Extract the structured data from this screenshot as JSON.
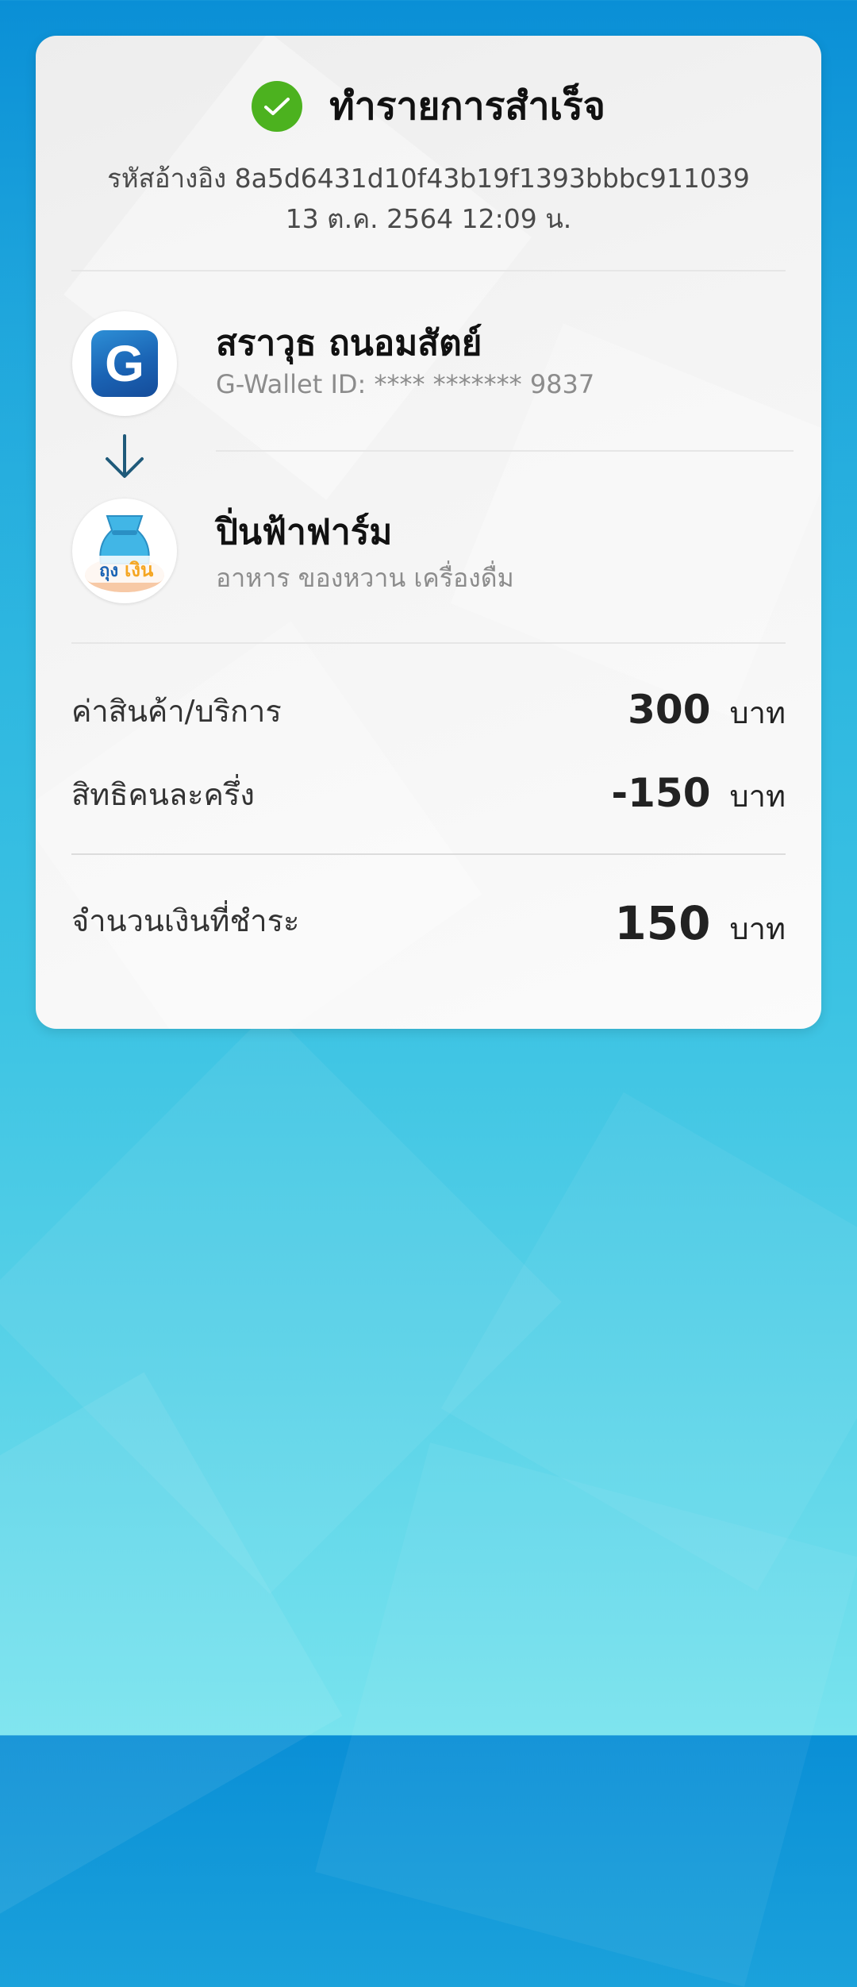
{
  "receipt": {
    "status_title": "ทำรายการสำเร็จ",
    "reference_line": "รหัสอ้างอิง 8a5d6431d10f43b19f1393bbbc911039",
    "datetime": "13 ต.ค. 2564 12:09 น."
  },
  "sender": {
    "logo_letter": "G",
    "name": "สราวุธ ถนอมสัตย์",
    "wallet_id": "G-Wallet ID: **** ******* 9837"
  },
  "merchant": {
    "logo_text": "ถุงเงิน",
    "name": "ปิ่นฟ้าฟาร์ม",
    "category": "อาหาร ของหวาน เครื่องดื่ม"
  },
  "summary": {
    "items": [
      {
        "label": "ค่าสินค้า/บริการ",
        "amount": "300",
        "unit": "บาท"
      },
      {
        "label": "สิทธิคนละครึ่ง",
        "amount": "-150",
        "unit": "บาท"
      }
    ],
    "total": {
      "label": "จำนวนเงินที่ชำระ",
      "amount": "150",
      "unit": "บาท"
    }
  },
  "icons": {
    "success": "check-circle-icon",
    "transfer": "arrow-down-icon"
  },
  "colors": {
    "success_green": "#4cb21f",
    "arrow": "#1f5a7a",
    "wallet_blue": "#1a63b4"
  }
}
